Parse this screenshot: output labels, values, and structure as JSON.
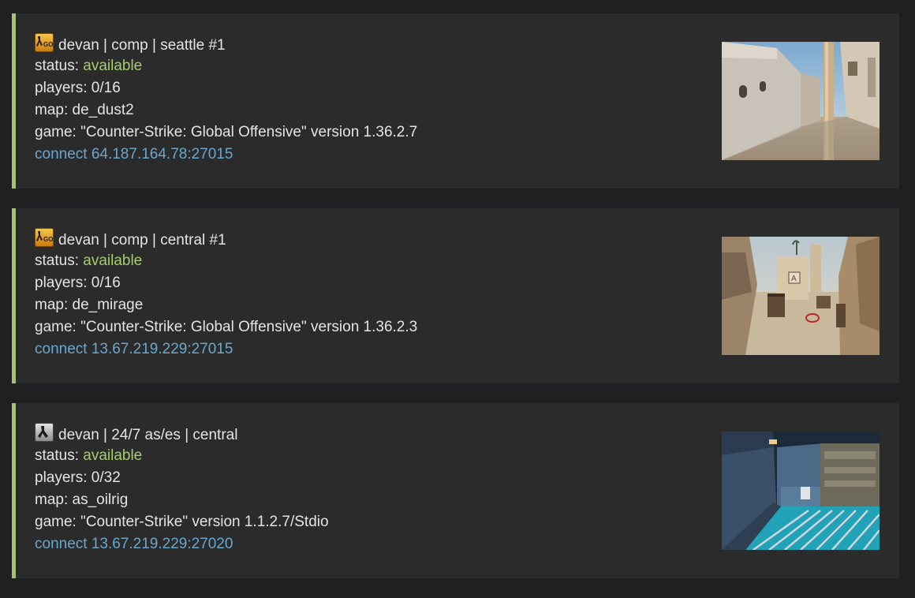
{
  "servers": [
    {
      "icon": "csgo-game-icon",
      "title": "devan | comp | seattle #1",
      "status_label": "status: ",
      "status_value": "available",
      "players": "players: 0/16",
      "map": "map: de_dust2",
      "game": "game: \"Counter-Strike: Global Offensive\" version 1.36.2.7",
      "connect": "connect 64.187.164.78:27015",
      "thumbnail": "de_dust2-map-thumbnail"
    },
    {
      "icon": "csgo-game-icon",
      "title": "devan | comp | central #1",
      "status_label": "status: ",
      "status_value": "available",
      "players": "players: 0/16",
      "map": "map: de_mirage",
      "game": "game: \"Counter-Strike: Global Offensive\" version 1.36.2.3",
      "connect": "connect 13.67.219.229:27015",
      "thumbnail": "de_mirage-map-thumbnail"
    },
    {
      "icon": "cs16-game-icon",
      "title": "devan | 24/7 as/es | central",
      "status_label": "status: ",
      "status_value": "available",
      "players": "players: 0/32",
      "map": "map: as_oilrig",
      "game": "game: \"Counter-Strike\" version 1.1.2.7/Stdio",
      "connect": "connect 13.67.219.229:27020",
      "thumbnail": "as_oilrig-map-thumbnail"
    }
  ],
  "colors": {
    "background": "#1f2022",
    "card": "#2b2b2b",
    "accent_border": "#a4c46a",
    "status_available": "#a6cc6c",
    "link": "#6aa7cf",
    "text": "#e4e4e4"
  }
}
